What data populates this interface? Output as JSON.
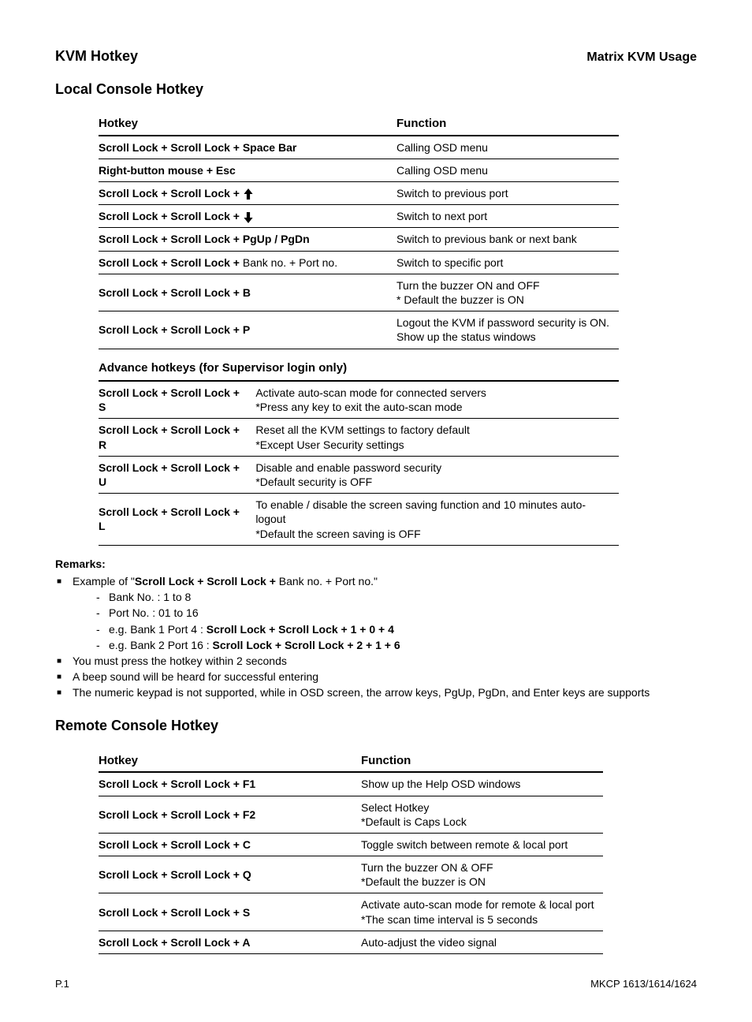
{
  "header": {
    "left": "KVM Hotkey",
    "right": "Matrix KVM Usage"
  },
  "section1": {
    "title": "Local Console Hotkey",
    "th_hotkey": "Hotkey",
    "th_function": "Function",
    "rows": [
      {
        "hk": "Scroll Lock  +  Scroll Lock  +   Space Bar",
        "fn": "Calling OSD menu"
      },
      {
        "hk": "Right-button mouse  +  Esc",
        "fn": "Calling OSD menu"
      },
      {
        "hk_prefix": "Scroll Lock  +  Scroll Lock  +",
        "icon": "up",
        "fn": "Switch to previous port"
      },
      {
        "hk_prefix": "Scroll Lock  +  Scroll Lock  +",
        "icon": "down",
        "fn": "Switch to next port"
      },
      {
        "hk": "Scroll Lock  +  Scroll Lock  +    PgUp / PgDn",
        "fn": "Switch to previous bank or next bank"
      },
      {
        "hk_prefix": "Scroll Lock  +  Scroll Lock  +",
        "hk_plain": "   Bank no.  +  Port no.",
        "fn": "Switch to specific port"
      },
      {
        "hk": "Scroll Lock  +  Scroll Lock  +    B",
        "fn": "Turn the buzzer ON and OFF\n* Default the buzzer is ON"
      },
      {
        "hk": "Scroll Lock  +  Scroll Lock  +    P",
        "fn": "Logout the KVM if password security is ON.  Show up the status windows"
      }
    ],
    "adv_title": "Advance hotkeys (for Supervisor login only)",
    "adv_rows": [
      {
        "hk": "Scroll Lock  +  Scroll Lock  +    S",
        "fn": "Activate auto-scan mode for connected servers\n*Press any key to exit the auto-scan mode"
      },
      {
        "hk": "Scroll Lock  +  Scroll Lock  +    R",
        "fn": "Reset all the KVM settings to factory default\n*Except User Security settings"
      },
      {
        "hk": "Scroll Lock  +  Scroll Lock  +    U",
        "fn": "Disable and enable password security\n*Default security is OFF"
      },
      {
        "hk": "Scroll Lock  +  Scroll Lock  +    L",
        "fn": "To enable / disable the screen saving function and 10 minutes auto-logout\n*Default the screen saving is OFF"
      }
    ]
  },
  "remarks": {
    "title": "Remarks:",
    "ex_prefix": "Example of \"",
    "ex_bold1": "Scroll Lock  +  Scroll Lock  +",
    "ex_plain1": "  Bank no.  +  Port no.\"",
    "bank": "Bank No. :  1 to 8",
    "port": "Port No. :  01 to 16",
    "eg1_prefix": "e.g. Bank 1 Port 4 :  ",
    "eg1_bold": "Scroll Lock   +   Scroll Lock   +   1   +   0   +   4",
    "eg2_prefix": "e.g. Bank 2 Port 16 :  ",
    "eg2_bold": "Scroll Lock   +   Scroll Lock   +   2   +   1   +   6",
    "b2": "You must press the hotkey within 2 seconds",
    "b3": "A beep sound will be heard for successful entering",
    "b4": "The numeric keypad is not supported, while in OSD screen, the arrow keys, PgUp, PgDn, and Enter keys are supports"
  },
  "section2": {
    "title": "Remote Console Hotkey",
    "th_hotkey": "Hotkey",
    "th_function": "Function",
    "rows": [
      {
        "hk": "Scroll Lock  +  Scroll Lock  +    F1",
        "fn": "Show up the Help OSD windows"
      },
      {
        "hk": "Scroll Lock  +  Scroll Lock  +    F2",
        "fn": "Select Hotkey\n*Default is Caps Lock"
      },
      {
        "hk": "Scroll Lock  +  Scroll Lock  +    C",
        "fn": "Toggle switch between remote & local port"
      },
      {
        "hk": "Scroll Lock  +  Scroll Lock  +    Q",
        "fn": "Turn the buzzer ON & OFF\n*Default the buzzer is ON"
      },
      {
        "hk": "Scroll Lock  +  Scroll Lock  +    S",
        "fn": "Activate auto-scan mode for remote & local port\n*The scan time interval is 5 seconds"
      },
      {
        "hk": "Scroll Lock  +  Scroll Lock  +    A",
        "fn": "Auto-adjust the video signal"
      }
    ]
  },
  "footer": {
    "page": "P.1",
    "model": "MKCP 1613/1614/1624"
  }
}
